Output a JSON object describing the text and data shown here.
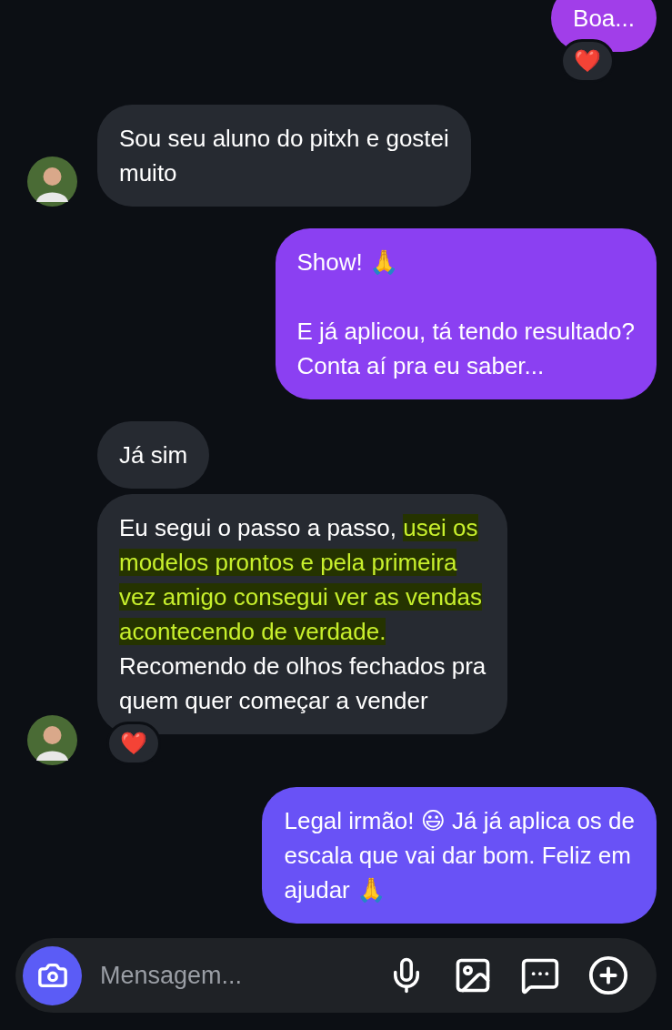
{
  "messages": [
    {
      "kind": "outgoing",
      "color": "#a13ee9",
      "text": "Boa...",
      "reactions": [
        "❤️"
      ]
    },
    {
      "kind": "incoming",
      "avatar": true,
      "text": "Sou seu aluno do pitxh e gostei\nmuito"
    },
    {
      "kind": "outgoing",
      "color": "#8b40f2",
      "text": "Show! 🙏\n\nE já aplicou, tá tendo resultado?\nConta aí pra eu saber..."
    },
    {
      "kind": "incoming",
      "avatar": false,
      "text": "Já sim"
    },
    {
      "kind": "incoming",
      "avatar": true,
      "segments": [
        {
          "text": "Eu segui o passo a passo, ",
          "highlighted": false
        },
        {
          "text": "usei os\nmodelos prontos e pela primeira\nvez amigo consegui ver as vendas\nacontecendo de verdade.",
          "highlighted": true
        },
        {
          "text": "\nRecomendo de olhos fechados pra\nquem quer começar a vender",
          "highlighted": false
        }
      ],
      "reactions": [
        "❤️"
      ]
    },
    {
      "kind": "outgoing",
      "color": "#6952f6",
      "text": "Legal irmão! 😃 Já já aplica os de\nescala que vai dar bom. Feliz em\najudar 🙏"
    }
  ],
  "composer": {
    "placeholder": "Mensagem..."
  }
}
